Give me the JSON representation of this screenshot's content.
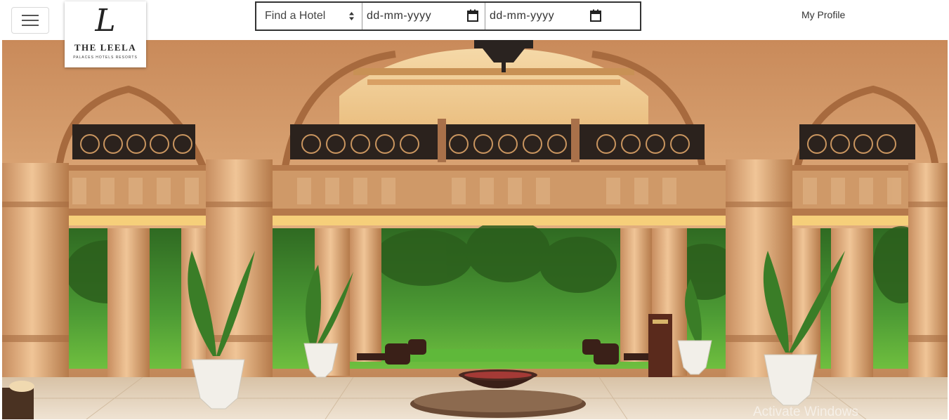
{
  "header": {
    "menu_icon": "hamburger-icon",
    "logo": {
      "name": "THE LEELA",
      "tagline": "PALACES HOTELS RESORTS",
      "monogram": "L"
    },
    "search": {
      "hotel_select": {
        "selected": "Find a Hotel",
        "icon": "select-arrows-icon"
      },
      "checkin_placeholder": "dd-mm-yyyy",
      "checkout_placeholder": "dd-mm-yyyy",
      "date_icon": "calendar-icon"
    },
    "profile_label": "My Profile"
  },
  "hero": {
    "alt": "Hotel lobby with carved arches, pillars, potted palms and a garden view",
    "overlay_text": "Activate Windows"
  },
  "colors": {
    "header_bg": "#ffffff",
    "search_border": "#333333",
    "stone": "#d9a678",
    "garden": "#3f8f2e"
  }
}
